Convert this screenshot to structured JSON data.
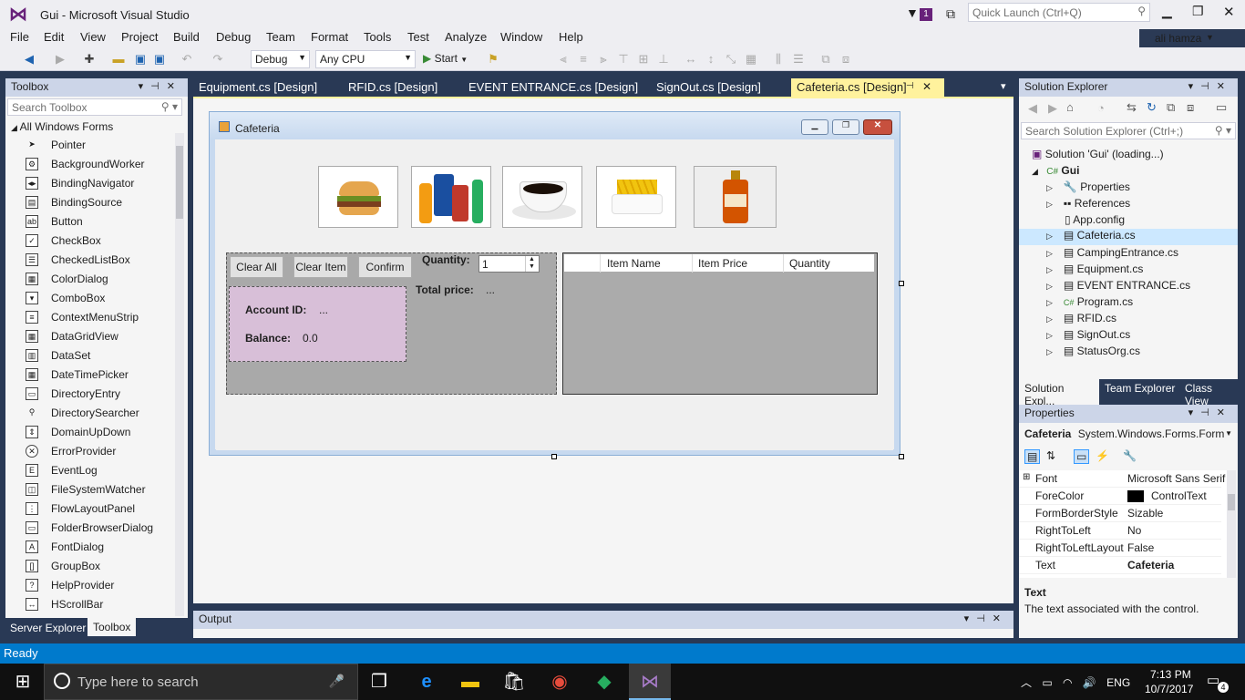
{
  "window": {
    "title": "Gui - Microsoft Visual Studio",
    "quick_launch_placeholder": "Quick Launch (Ctrl+Q)",
    "user": "ali hamza",
    "notif_count": "1"
  },
  "menu": [
    "File",
    "Edit",
    "View",
    "Project",
    "Build",
    "Debug",
    "Team",
    "Format",
    "Tools",
    "Test",
    "Analyze",
    "Window",
    "Help"
  ],
  "toolbar": {
    "config": "Debug",
    "platform": "Any CPU",
    "start_label": "Start"
  },
  "toolbox": {
    "title": "Toolbox",
    "search_placeholder": "Search Toolbox",
    "group": "All Windows Forms",
    "items": [
      "Pointer",
      "BackgroundWorker",
      "BindingNavigator",
      "BindingSource",
      "Button",
      "CheckBox",
      "CheckedListBox",
      "ColorDialog",
      "ComboBox",
      "ContextMenuStrip",
      "DataGridView",
      "DataSet",
      "DateTimePicker",
      "DirectoryEntry",
      "DirectorySearcher",
      "DomainUpDown",
      "ErrorProvider",
      "EventLog",
      "FileSystemWatcher",
      "FlowLayoutPanel",
      "FolderBrowserDialog",
      "FontDialog",
      "GroupBox",
      "HelpProvider",
      "HScrollBar"
    ],
    "tabs": [
      "Server Explorer",
      "Toolbox"
    ]
  },
  "doc_tabs": [
    "Equipment.cs [Design]",
    "RFID.cs [Design]",
    "EVENT ENTRANCE.cs [Design]",
    "SignOut.cs [Design]",
    "Cafeteria.cs [Design]"
  ],
  "form": {
    "title": "Cafeteria",
    "buttons": {
      "clear_all": "Clear All",
      "clear_item": "Clear Item",
      "confirm": "Confirm"
    },
    "quantity_label": "Quantity:",
    "quantity_value": "1",
    "total_label": "Total price:",
    "total_value": "...",
    "account_label": "Account ID:",
    "account_value": "...",
    "balance_label": "Balance:",
    "balance_value": "0.0",
    "grid_columns": [
      "Item Name",
      "Item Price",
      "Quantity"
    ],
    "images": [
      "burger-image",
      "soda-image",
      "coffee-image",
      "fries-image",
      "bottle-image"
    ]
  },
  "solution_explorer": {
    "title": "Solution Explorer",
    "search_placeholder": "Search Solution Explorer (Ctrl+;)",
    "solution": "Solution 'Gui' (loading...)",
    "project": "Gui",
    "items": [
      "Properties",
      "References",
      "App.config",
      "Cafeteria.cs",
      "CampingEntrance.cs",
      "Equipment.cs",
      "EVENT ENTRANCE.cs",
      "Program.cs",
      "RFID.cs",
      "SignOut.cs",
      "StatusOrg.cs"
    ],
    "tabs": [
      "Solution Expl...",
      "Team Explorer",
      "Class View"
    ]
  },
  "properties": {
    "title": "Properties",
    "object_name": "Cafeteria",
    "object_type": "System.Windows.Forms.Form",
    "rows": [
      {
        "k": "Font",
        "v": "Microsoft Sans Serif"
      },
      {
        "k": "ForeColor",
        "v": "ControlText"
      },
      {
        "k": "FormBorderStyle",
        "v": "Sizable"
      },
      {
        "k": "RightToLeft",
        "v": "No"
      },
      {
        "k": "RightToLeftLayout",
        "v": "False"
      },
      {
        "k": "Text",
        "v": "Cafeteria"
      }
    ],
    "desc_title": "Text",
    "desc_text": "The text associated with the control."
  },
  "output": {
    "title": "Output"
  },
  "status": {
    "text": "Ready"
  },
  "taskbar": {
    "search_placeholder": "Type here to search",
    "lang": "ENG",
    "time": "7:13 PM",
    "date": "10/7/2017",
    "notifications": "4"
  }
}
